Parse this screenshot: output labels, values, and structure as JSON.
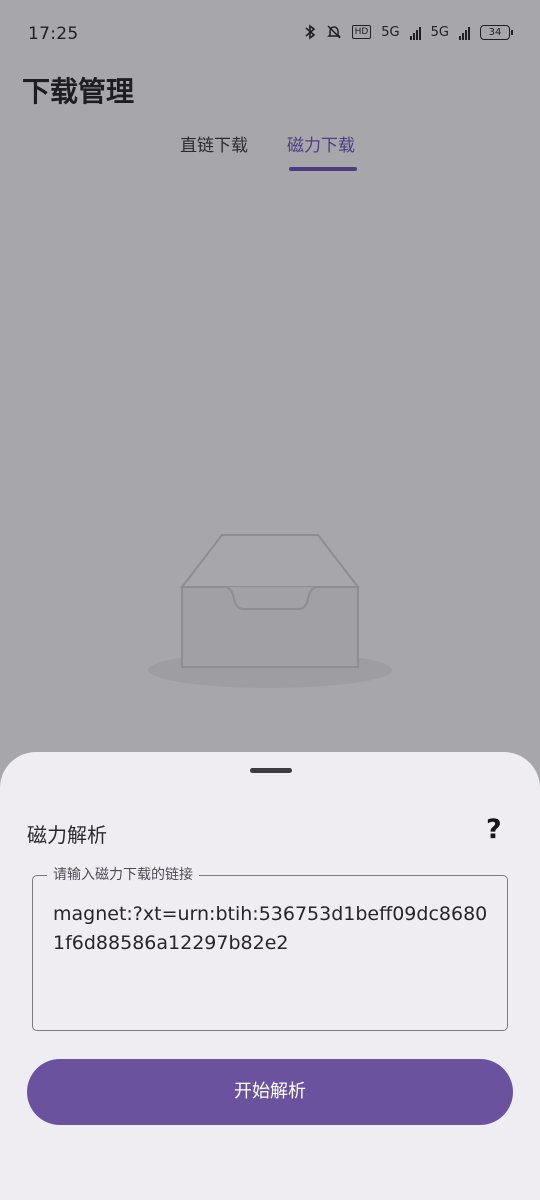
{
  "status_bar": {
    "time": "17:25",
    "hd_label": "HD",
    "network_1": "5G",
    "network_2": "5G",
    "battery": "34"
  },
  "header": {
    "title": "下载管理"
  },
  "tabs": [
    {
      "label": "直链下载",
      "selected": false
    },
    {
      "label": "磁力下载",
      "selected": true
    }
  ],
  "colors": {
    "accent": "#6a529f",
    "tab_selected": "#4d3c85",
    "scrim_background": "#a7a7ab",
    "sheet_background": "#efedf1"
  },
  "bottom_sheet": {
    "title": "磁力解析",
    "help_icon": "?",
    "input": {
      "label": "请输入磁力下载的链接",
      "value": "magnet:?xt=urn:btih:536753d1beff09dc86801f6d88586a12297b82e2"
    },
    "submit_label": "开始解析"
  },
  "icons": {
    "bluetooth": "bluetooth-icon",
    "mute": "bell-off-icon",
    "empty_state": "empty-inbox-icon",
    "help": "question-mark-icon"
  }
}
